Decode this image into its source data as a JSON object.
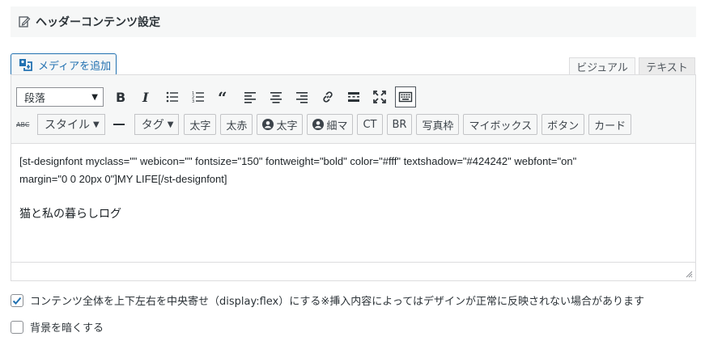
{
  "section": {
    "title": "ヘッダーコンテンツ設定"
  },
  "media_button": {
    "label": "メディアを追加"
  },
  "tabs": {
    "visual": "ビジュアル",
    "text": "テキスト"
  },
  "toolbar": {
    "format_select": "段落",
    "row1_icons": [
      "bold-icon",
      "italic-icon",
      "bullet-list-icon",
      "numbered-list-icon",
      "blockquote-icon",
      "align-left-icon",
      "align-center-icon",
      "align-right-icon",
      "link-icon",
      "read-more-icon",
      "fullscreen-icon",
      "keyboard-icon"
    ],
    "strikethrough_label": "ABC",
    "style_dropdown": "スタイル",
    "tag_dropdown": "タグ",
    "buttons": {
      "bold_jp": "太字",
      "red": "太赤",
      "user_bold": "太字",
      "user_thin": "細マ",
      "ct": "CT",
      "br": "BR",
      "photo_frame": "写真枠",
      "mybox": "マイボックス",
      "button": "ボタン",
      "card": "カード"
    }
  },
  "editor": {
    "line1": "[st-designfont myclass=\"\" webicon=\"\" fontsize=\"150\" fontweight=\"bold\" color=\"#fff\" textshadow=\"#424242\" webfont=\"on\"",
    "line2": "margin=\"0 0 20px 0\"]MY LIFE[/st-designfont]",
    "line3": "猫と私の暮らしログ"
  },
  "options": {
    "center_flex": {
      "label": "コンテンツ全体を上下左右を中央寄せ（display:flex）にする※挿入内容によってはデザインが正常に反映されない場合があります",
      "checked": true
    },
    "darken_bg": {
      "label": "背景を暗くする",
      "checked": false
    }
  },
  "colors": {
    "accent": "#2271b1",
    "check": "#2271b1"
  }
}
